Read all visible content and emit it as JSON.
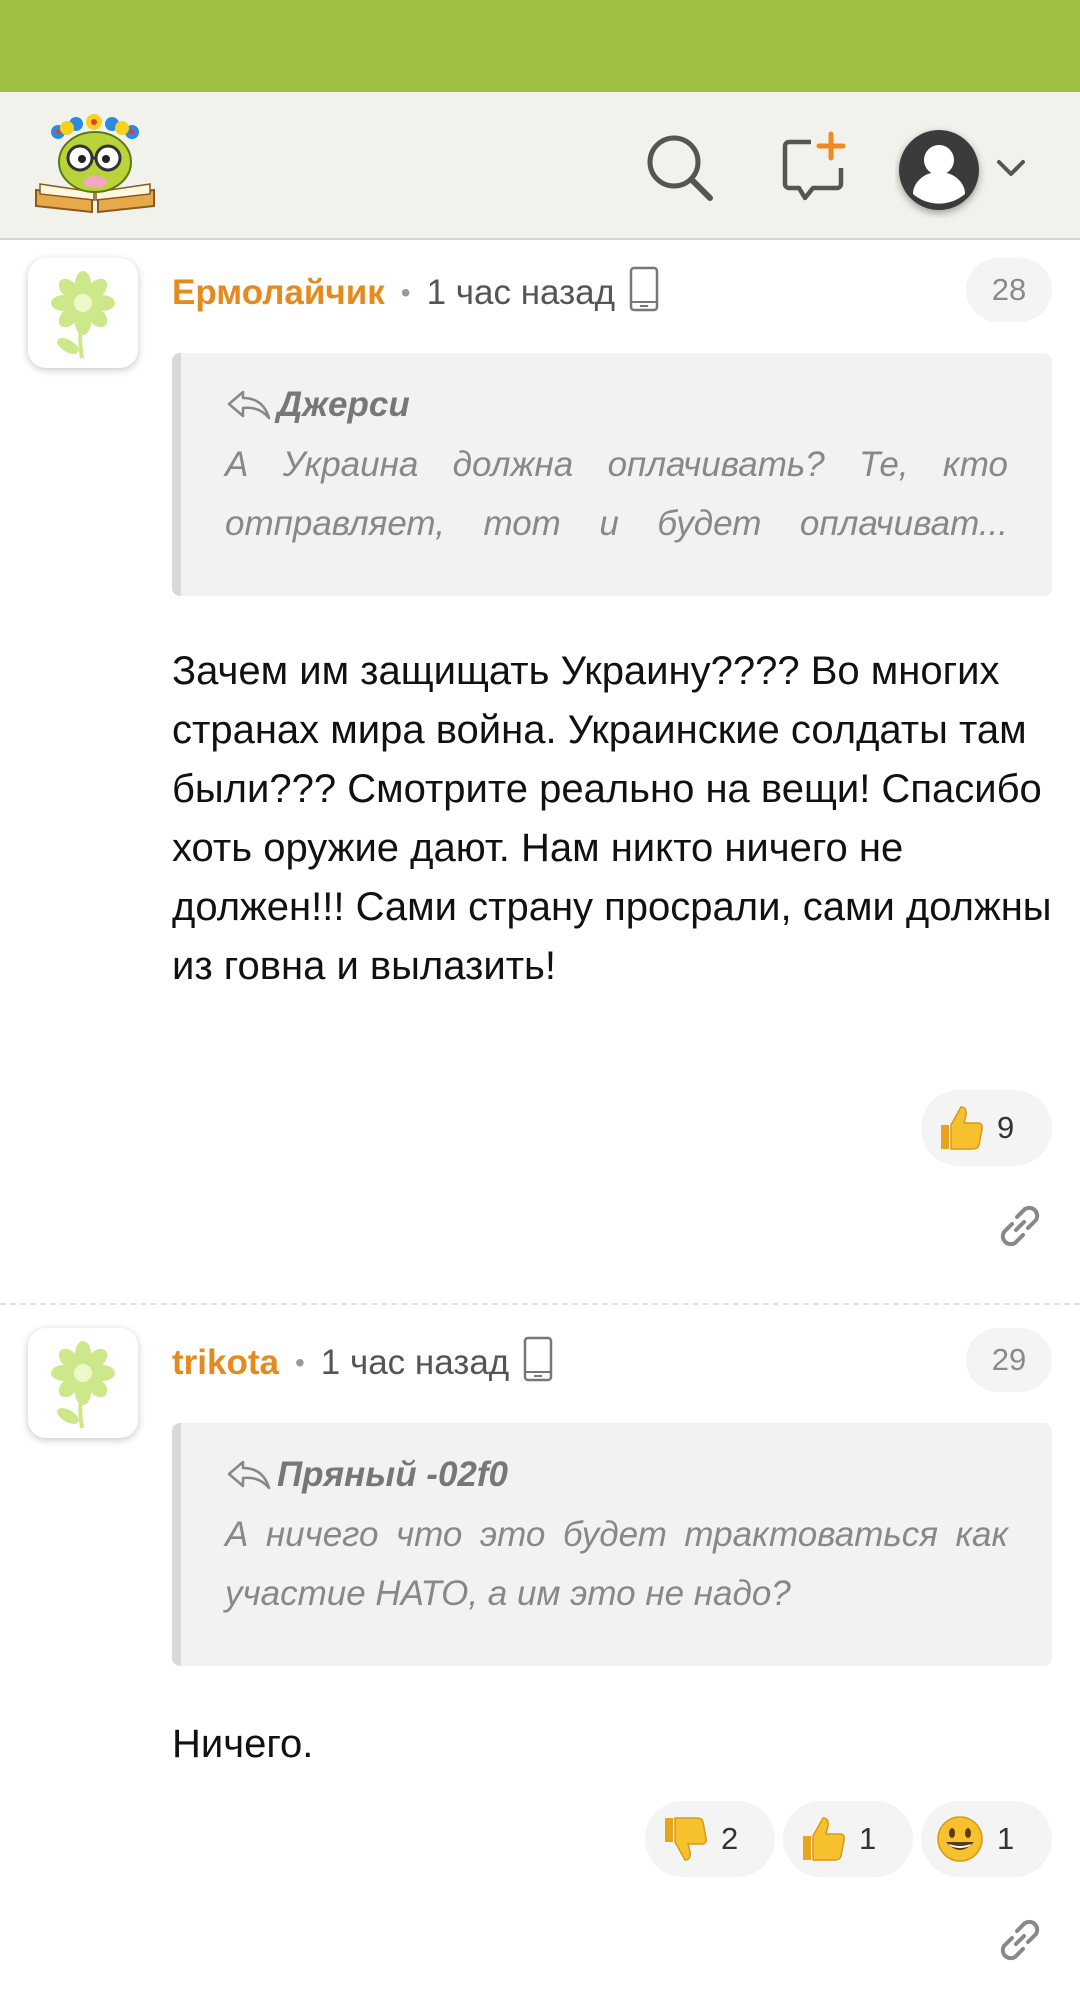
{
  "header": {
    "logo_name": "site-logo",
    "icons": [
      "search-icon",
      "new-post-icon",
      "account-icon",
      "chevron-down-icon"
    ]
  },
  "comments": [
    {
      "author": "Ермолайчик",
      "time": "1 час назад",
      "number": "28",
      "quote_author": "Джерси",
      "quote_text": "А Украина должна оплачивать? Те, кто отправляет, тот и будет оплачиват...",
      "body": "Зачем им защищать Украину???? Во многих странах мира война. Украинские солдаты там были??? Смотрите реально на вещи! Спасибо хоть оружие дают. Нам никто ничего не должен!!! Сами страну просрали, сами должны из говна и вылазить!",
      "reactions": [
        {
          "icon": "thumbs-up-icon",
          "count": "9"
        }
      ]
    },
    {
      "author": "trikota",
      "time": "1 час назад",
      "number": "29",
      "quote_author": "Пряный -02f0",
      "quote_text": "А ничего что это будет трактоваться как участие НАТО, а им это не надо?",
      "body": "Ничего.",
      "reactions": [
        {
          "icon": "thumbs-down-icon",
          "count": "2"
        },
        {
          "icon": "thumbs-up-icon",
          "count": "1"
        },
        {
          "icon": "smile-icon",
          "count": "1"
        }
      ]
    }
  ],
  "colors": {
    "status_bar": "#9ec144",
    "author": "#e58a1f",
    "header_bg": "#f2f2ec"
  }
}
